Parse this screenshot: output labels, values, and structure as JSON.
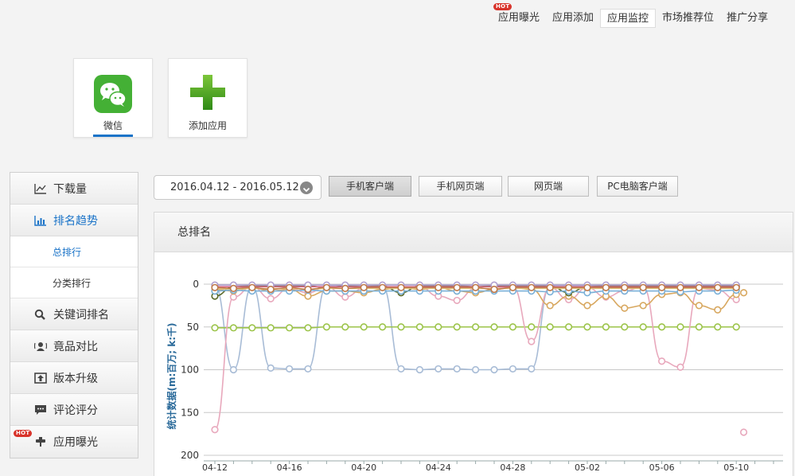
{
  "topnav": {
    "items": [
      {
        "label": "应用曝光",
        "hot": true
      },
      {
        "label": "应用添加"
      },
      {
        "label": "应用监控",
        "active": true
      },
      {
        "label": "市场推荐位"
      },
      {
        "label": "推广分享"
      }
    ],
    "hot_label": "HOT"
  },
  "apps": [
    {
      "label": "微信",
      "icon": "wechat-icon",
      "selected": true
    },
    {
      "label": "添加应用",
      "icon": "plus-icon"
    }
  ],
  "sidebar": {
    "items": [
      {
        "label": "下载量",
        "icon": "line-chart-icon"
      },
      {
        "label": "排名趋势",
        "icon": "bar-chart-icon",
        "active": true
      },
      {
        "label": "关键词排名",
        "icon": "search-icon"
      },
      {
        "label": "竟品对比",
        "icon": "user-compare-icon"
      },
      {
        "label": "版本升级",
        "icon": "upgrade-icon"
      },
      {
        "label": "评论评分",
        "icon": "comment-icon"
      },
      {
        "label": "应用曝光",
        "icon": "exposure-icon",
        "hot": true
      }
    ],
    "subitems": [
      {
        "label": "总排行",
        "active": true
      },
      {
        "label": "分类排行"
      }
    ]
  },
  "filters": {
    "date_range": "2016.04.12 - 2016.05.12",
    "platforms": [
      {
        "label": "手机客户端",
        "active": true
      },
      {
        "label": "手机网页端"
      },
      {
        "label": "网页端"
      },
      {
        "label": "PC电脑客户端"
      }
    ]
  },
  "panel": {
    "title": "总排名"
  },
  "colors": {
    "accent": "#1a73c8",
    "hot": "#d8332a",
    "wechat": "#44b035",
    "plus": "#3c9a1c"
  },
  "chart_data": {
    "type": "line",
    "ylabel": "统计数据(m:百万; k:千)",
    "y_reversed": true,
    "ylim": [
      0,
      200
    ],
    "yticks": [
      0,
      50,
      100,
      150,
      200
    ],
    "grid": true,
    "x_tick_labels": [
      "04-12",
      "04-16",
      "04-20",
      "04-24",
      "04-28",
      "05-02",
      "05-06",
      "05-10"
    ],
    "x_tick_every": 4,
    "n_points": 29,
    "series": [
      {
        "color": "#a8bcd6",
        "values": [
          2,
          100,
          2,
          98,
          99,
          99,
          2,
          2,
          2,
          2,
          99,
          100,
          99,
          99,
          100,
          100,
          99,
          99,
          2,
          2,
          2,
          2,
          2,
          2,
          2,
          2,
          2,
          2,
          2
        ]
      },
      {
        "color": "#9cc44a",
        "values": [
          51,
          51,
          51,
          51,
          51,
          51,
          50,
          50,
          50,
          50,
          50,
          50,
          50,
          50,
          50,
          50,
          50,
          50,
          50,
          50,
          50,
          50,
          50,
          50,
          50,
          50,
          50,
          50,
          50
        ]
      },
      {
        "color": "#e8a8bc",
        "values": [
          170,
          15,
          3,
          17,
          5,
          10,
          3,
          15,
          5,
          3,
          5,
          3,
          14,
          19,
          5,
          5,
          3,
          67,
          4,
          18,
          4,
          15,
          8,
          3,
          90,
          97,
          5,
          7,
          18,
          null,
          173
        ]
      },
      {
        "color": "#d8a860",
        "values": [
          6,
          8,
          4,
          8,
          6,
          14,
          8,
          8,
          10,
          6,
          4,
          6,
          4,
          8,
          10,
          6,
          4,
          6,
          25,
          14,
          25,
          14,
          28,
          25,
          12,
          10,
          25,
          30,
          12,
          10
        ]
      },
      {
        "color": "#5a6a2a",
        "values": [
          14,
          3,
          2,
          2,
          2,
          2,
          4,
          2,
          3,
          2,
          10,
          2,
          2,
          2,
          3,
          2,
          2,
          2,
          2,
          10,
          3,
          2,
          2,
          2,
          2,
          2,
          2,
          2,
          2
        ]
      },
      {
        "color": "#d86a8a",
        "values": [
          3,
          3,
          3,
          3,
          3,
          3,
          3,
          3,
          3,
          3,
          3,
          3,
          3,
          3,
          3,
          3,
          3,
          3,
          3,
          3,
          3,
          3,
          3,
          3,
          3,
          3,
          3,
          3,
          3
        ]
      },
      {
        "color": "#e6d08a",
        "values": [
          5,
          6,
          5,
          5,
          5,
          6,
          5,
          5,
          5,
          5,
          5,
          5,
          5,
          5,
          5,
          5,
          5,
          5,
          5,
          5,
          5,
          5,
          5,
          5,
          5,
          5,
          5,
          5,
          5
        ]
      },
      {
        "color": "#b0a0d0",
        "values": [
          1,
          1,
          1,
          1,
          1,
          1,
          1,
          1,
          1,
          1,
          1,
          1,
          1,
          1,
          1,
          1,
          1,
          1,
          1,
          1,
          1,
          1,
          1,
          1,
          1,
          1,
          1,
          1,
          1
        ]
      },
      {
        "color": "#7ab0d8",
        "values": [
          8,
          7,
          8,
          8,
          8,
          7,
          8,
          8,
          8,
          8,
          8,
          8,
          8,
          8,
          8,
          8,
          8,
          8,
          9,
          8,
          10,
          8,
          8,
          8,
          8,
          9,
          8,
          8,
          7
        ]
      },
      {
        "color": "#c07a4a",
        "values": [
          4,
          5,
          4,
          6,
          4,
          6,
          4,
          5,
          4,
          4,
          4,
          4,
          4,
          4,
          4,
          6,
          4,
          4,
          4,
          4,
          4,
          4,
          4,
          4,
          4,
          4,
          4,
          4,
          4
        ]
      }
    ]
  }
}
